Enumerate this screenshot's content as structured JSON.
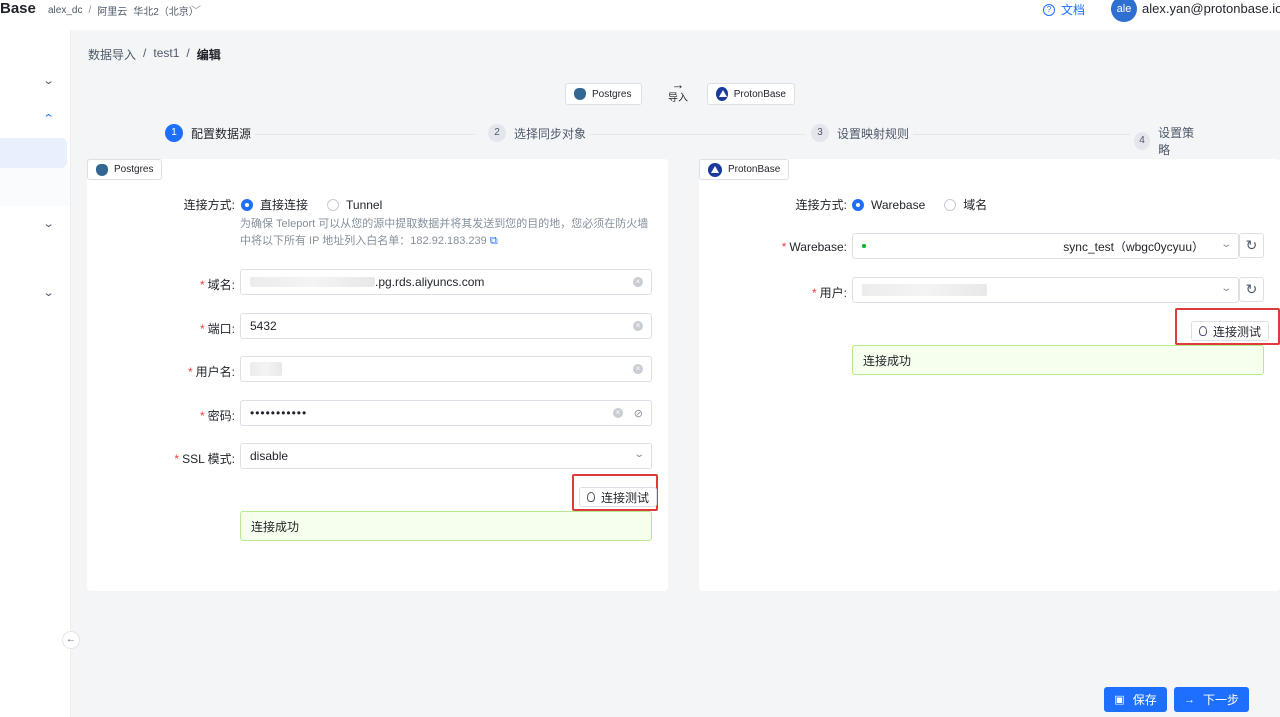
{
  "app": {
    "logo": "Base"
  },
  "top": {
    "account": "alex_dc",
    "sep": "/",
    "cloud": "阿里云",
    "region": "华北2（北京）",
    "docs_label": "文档",
    "avatar_initials": "ale",
    "user_email": "alex.yan@protonbase.io"
  },
  "breadcrumb": {
    "items": [
      "数据导入",
      "test1",
      "编辑"
    ],
    "sep": "/"
  },
  "flow": {
    "source": "Postgres",
    "target": "ProtonBase",
    "arrow": "→",
    "arrow_label": "导入"
  },
  "steps": [
    {
      "num": "1",
      "label": "配置数据源",
      "active": true
    },
    {
      "num": "2",
      "label": "选择同步对象",
      "active": false
    },
    {
      "num": "3",
      "label": "设置映射规则",
      "active": false
    },
    {
      "num": "4",
      "label": "设置策略",
      "active": false
    }
  ],
  "left_panel": {
    "tag": "Postgres",
    "conn_mode_label": "连接方式:",
    "conn_options": [
      "直接连接",
      "Tunnel"
    ],
    "selected_option": "直接连接",
    "hint_line1": "为确保 Teleport 可以从您的源中提取数据并将其发送到您的目的地，您必须在防火墙",
    "hint_line2": "中将以下所有 IP 地址列入白名单：182.92.183.239",
    "fields": {
      "domain": {
        "label": "域名:",
        "value": ".pg.rds.aliyuncs.com"
      },
      "port": {
        "label": "端口:",
        "value": "5432"
      },
      "username": {
        "label": "用户名:",
        "value": ""
      },
      "password": {
        "label": "密码:",
        "value": "•••••••••••"
      },
      "ssl": {
        "label": "SSL 模式:",
        "value": "disable"
      }
    },
    "test_button": "连接测试",
    "result": "连接成功"
  },
  "right_panel": {
    "tag": "ProtonBase",
    "conn_mode_label": "连接方式:",
    "conn_options": [
      "Warebase",
      "域名"
    ],
    "selected_option": "Warebase",
    "warebase_label": "Warebase:",
    "warebase_value": "sync_test（wbgc0ycyuu）",
    "user_label": "用户:",
    "test_button": "连接测试",
    "result": "连接成功"
  },
  "footer": {
    "save": "保存",
    "next": "下一步"
  },
  "colors": {
    "accent": "#1f6fff",
    "success_bg": "#f6ffed",
    "highlight": "#e03a3a"
  }
}
